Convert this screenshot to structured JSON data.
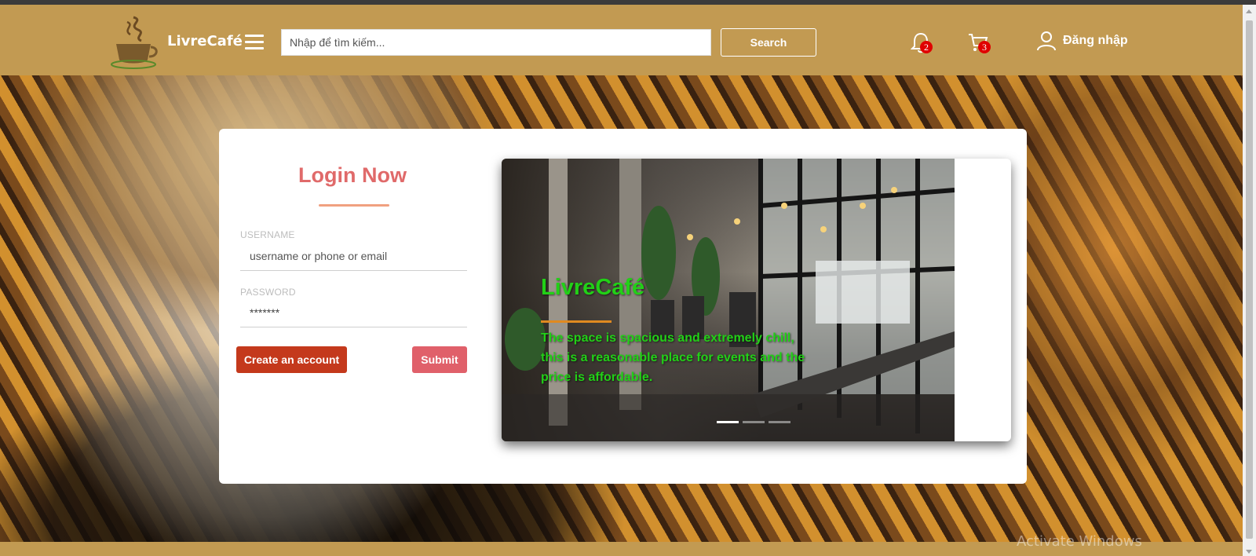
{
  "header": {
    "brand": "LivreCafé",
    "search_placeholder": "Nhập để tìm kiếm...",
    "search_label": "Search",
    "notifications_count": "2",
    "cart_count": "3",
    "login_label": "Đăng nhập"
  },
  "login": {
    "title": "Login Now",
    "username_label": "USERNAME",
    "username_placeholder": "username or phone or email",
    "password_label": "PASSWORD",
    "password_value": "*******",
    "create_account_label": "Create an account",
    "submit_label": "Submit"
  },
  "carousel": {
    "title": "LivreCafé",
    "text": "The space is spacious and extremely chill, this is a reasonable place for events and the price is affordable.",
    "slide_count": 3,
    "active_index": 0
  },
  "watermark": "Activate Windows",
  "colors": {
    "header_bg": "#c29a52",
    "title_color": "#e06a6a",
    "create_btn": "#c4391c",
    "submit_btn": "#e0606a",
    "caption_green": "#22d017"
  }
}
